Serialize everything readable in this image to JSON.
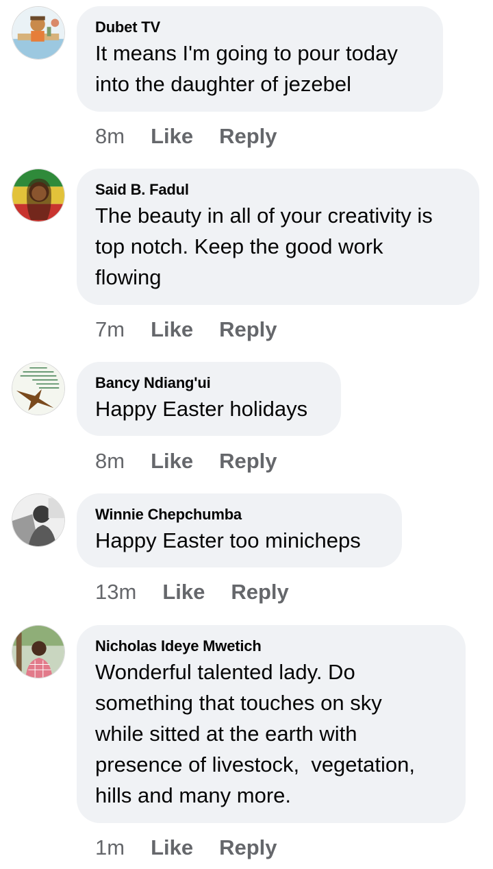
{
  "comments": [
    {
      "author": "Dubet TV",
      "text": "It means I'm going to pour today\ninto the daughter of jezebel",
      "time": "8m",
      "like_label": "Like",
      "reply_label": "Reply",
      "avatar_icon": "cartoon-avatar-icon"
    },
    {
      "author": "Said B. Fadul",
      "text": "The beauty in all of your creativity is\ntop notch. Keep the good work\nflowing",
      "time": "7m",
      "like_label": "Like",
      "reply_label": "Reply",
      "avatar_icon": "portrait-avatar-icon"
    },
    {
      "author": "Bancy Ndiang'ui",
      "text": "Happy Easter holidays",
      "time": "8m",
      "like_label": "Like",
      "reply_label": "Reply",
      "avatar_icon": "eagle-avatar-icon"
    },
    {
      "author": "Winnie Chepchumba",
      "text": "Happy Easter too minicheps",
      "time": "13m",
      "like_label": "Like",
      "reply_label": "Reply",
      "avatar_icon": "photo-avatar-icon"
    },
    {
      "author": "Nicholas Ideye Mwetich",
      "text": "Wonderful talented lady. Do\nsomething that touches on sky\nwhile sitted at the earth with\npresence of livestock,  vegetation,\nhills and many more.",
      "time": "1m",
      "like_label": "Like",
      "reply_label": "Reply",
      "avatar_icon": "person-avatar-icon"
    }
  ],
  "colors": {
    "bubble_bg": "#f0f2f5",
    "meta_text": "#65676b",
    "primary_text": "#050505"
  }
}
